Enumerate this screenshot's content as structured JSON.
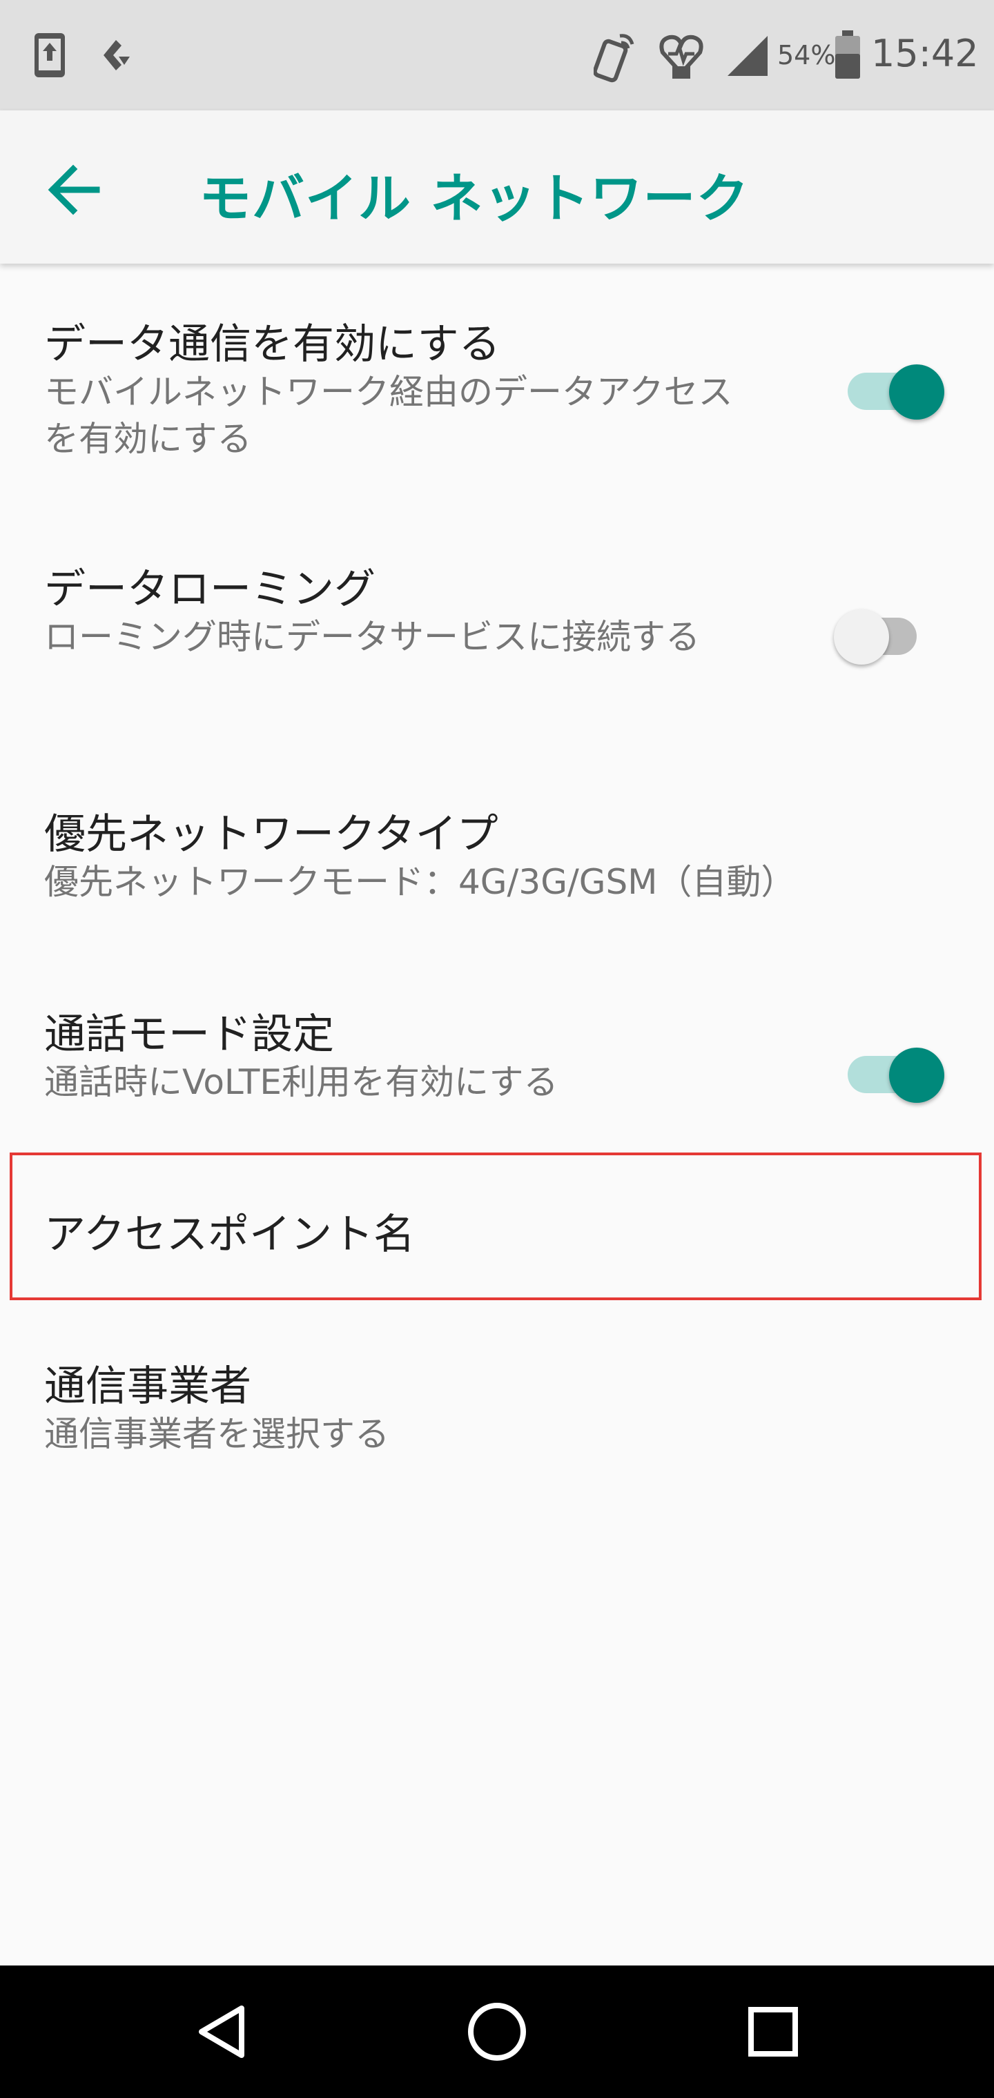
{
  "status_bar": {
    "battery_percent": "54%",
    "time": "15:42",
    "left_icons": [
      "upload-notification-icon",
      "download-notification-icon"
    ],
    "right_icons": [
      "nfc-icon",
      "heart-health-icon",
      "signal-icon",
      "battery-icon"
    ]
  },
  "app_bar": {
    "title": "モバイル ネットワーク",
    "back_icon": "arrow-back-icon",
    "accent_color": "#009688"
  },
  "settings": [
    {
      "title": "データ通信を有効にする",
      "summary": "モバイルネットワーク経由のデータアクセスを有効にする",
      "toggle": true
    },
    {
      "title": "データローミング",
      "summary": "ローミング時にデータサービスに接続する",
      "toggle": false
    },
    {
      "title": "優先ネットワークタイプ",
      "summary": "優先ネットワークモード：4G/3G/GSM（自動）"
    },
    {
      "title": "通話モード設定",
      "summary": "通話時にVoLTE利用を有効にする",
      "toggle": true
    },
    {
      "title": "アクセスポイント名",
      "highlighted": true,
      "highlight_color": "#e53935"
    },
    {
      "title": "通信事業者",
      "summary": "通信事業者を選択する"
    }
  ],
  "nav_bar": {
    "buttons": [
      "back-triangle-icon",
      "home-circle-icon",
      "recents-square-icon"
    ]
  }
}
